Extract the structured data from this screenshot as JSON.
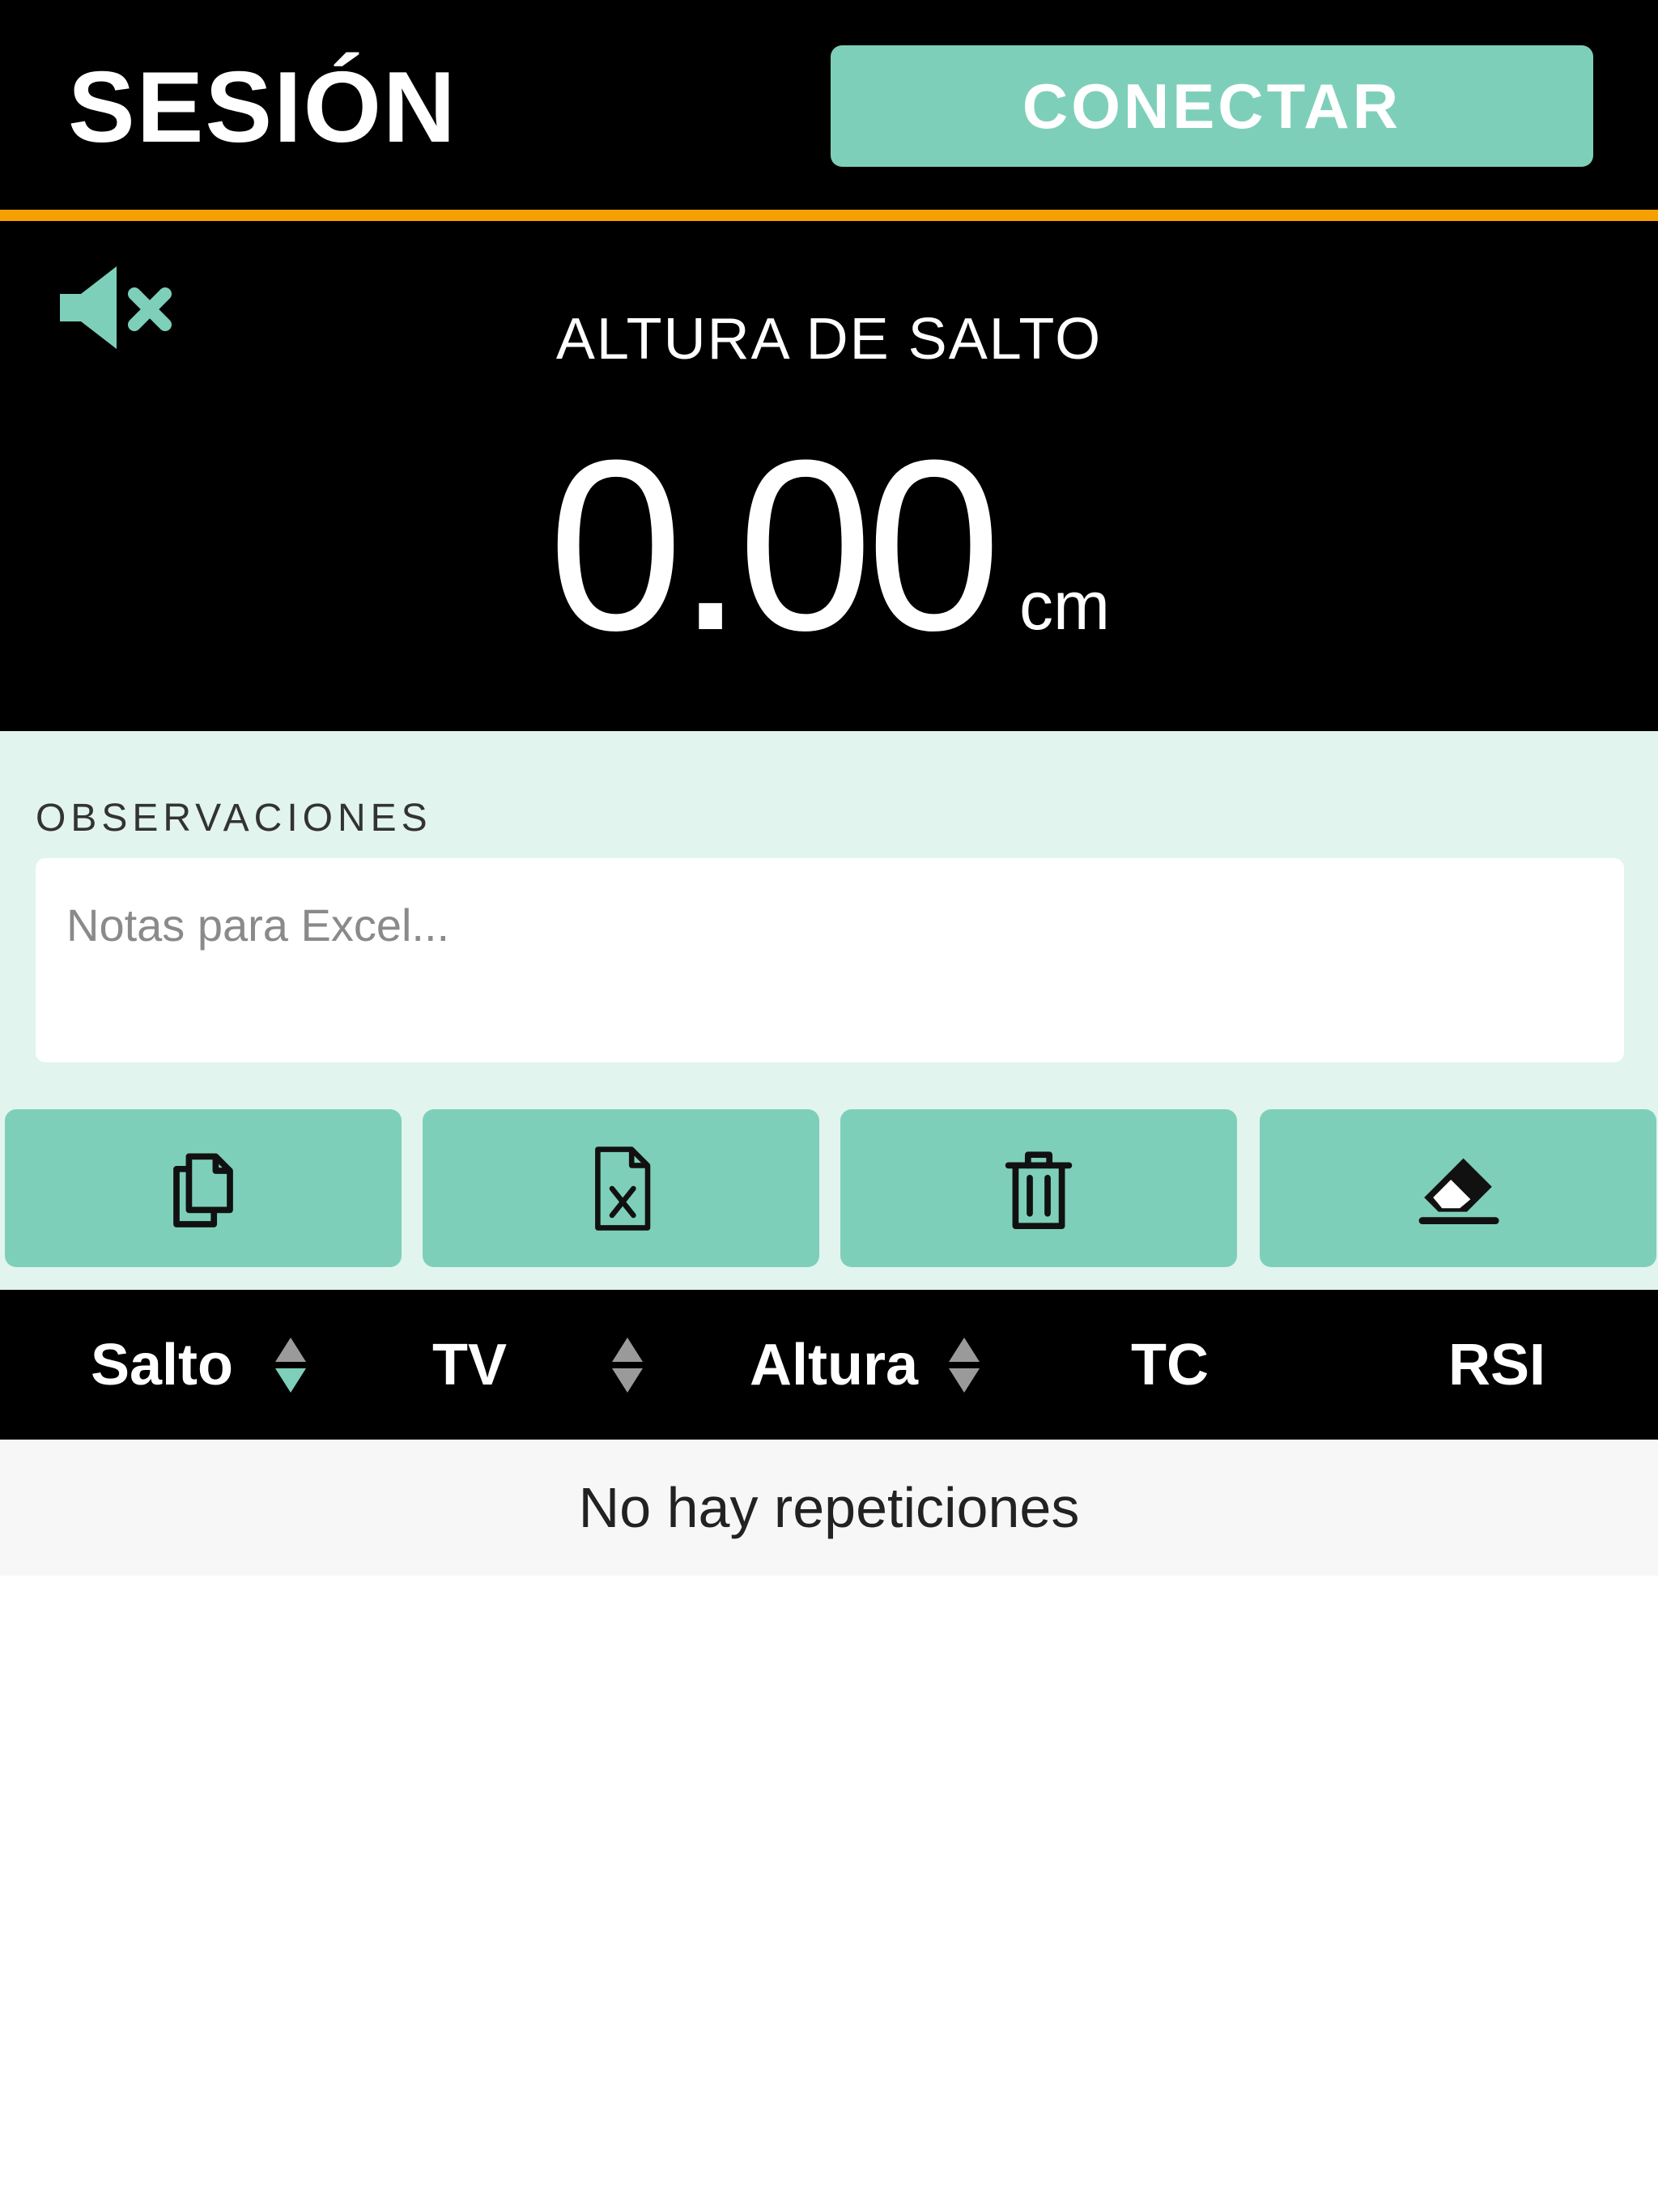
{
  "header": {
    "title": "SESIÓN",
    "connect_label": "CONECTAR"
  },
  "measurement": {
    "mute_icon": "speaker-muted-icon",
    "label": "ALTURA DE SALTO",
    "value": "0.00",
    "unit": "cm"
  },
  "observations": {
    "label": "OBSERVACIONES",
    "placeholder": "Notas para Excel...",
    "value": ""
  },
  "actions": [
    {
      "icon": "copy-icon"
    },
    {
      "icon": "excel-file-icon"
    },
    {
      "icon": "trash-icon"
    },
    {
      "icon": "eraser-icon"
    }
  ],
  "table": {
    "columns": [
      "Salto",
      "TV",
      "Altura",
      "TC",
      "RSI"
    ],
    "sortable": [
      true,
      true,
      true,
      false,
      false
    ],
    "empty_message": "No hay repeticiones"
  },
  "colors": {
    "accent": "#7ecfb9",
    "divider": "#f5a000",
    "background_dark": "#000000",
    "panel": "#e2f4ee"
  }
}
